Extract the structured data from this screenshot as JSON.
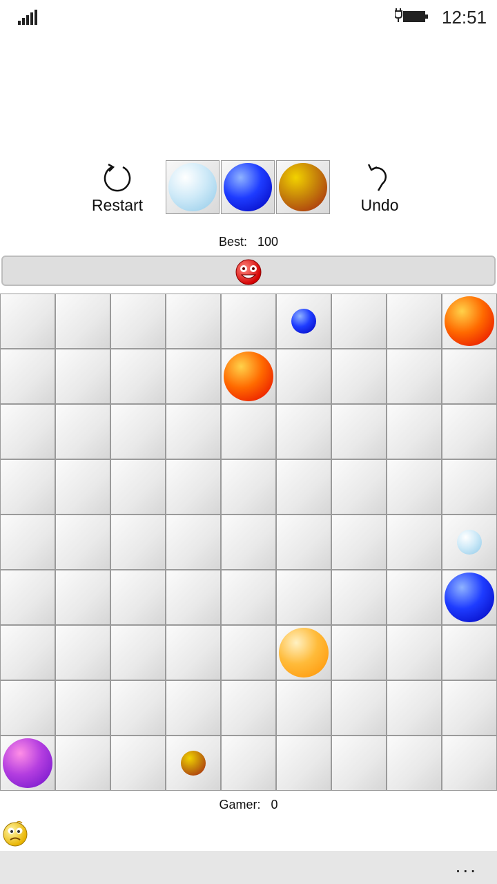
{
  "status": {
    "time": "12:51",
    "signal_icon": "signal-bars-icon",
    "battery_icon": "battery-charging-icon"
  },
  "toolbar": {
    "restart_label": "Restart",
    "restart_icon": "restart-icon",
    "undo_label": "Undo",
    "undo_icon": "undo-icon"
  },
  "next_balls": [
    "lightblue",
    "blue",
    "brown"
  ],
  "best": {
    "label": "Best:",
    "value": "100"
  },
  "progress": {
    "fraction": 0.5,
    "icon": "smiley-face-icon"
  },
  "board": {
    "columns": 9,
    "rows": 9,
    "balls": [
      {
        "row": 0,
        "col": 5,
        "color": "blue",
        "size": "small"
      },
      {
        "row": 0,
        "col": 8,
        "color": "red",
        "size": "large"
      },
      {
        "row": 1,
        "col": 4,
        "color": "red",
        "size": "large"
      },
      {
        "row": 4,
        "col": 8,
        "color": "lightblue",
        "size": "small"
      },
      {
        "row": 5,
        "col": 8,
        "color": "blue",
        "size": "large"
      },
      {
        "row": 6,
        "col": 5,
        "color": "orange",
        "size": "large"
      },
      {
        "row": 8,
        "col": 0,
        "color": "purple",
        "size": "large"
      },
      {
        "row": 8,
        "col": 3,
        "color": "brown",
        "size": "small"
      }
    ]
  },
  "gamer": {
    "label": "Gamer:",
    "value": "0"
  },
  "gamer_icon": "worried-face-icon",
  "app_bar": {
    "more_label": "..."
  },
  "colors": {
    "red": [
      "#ffd24a",
      "#ff6a00",
      "#e30000"
    ],
    "blue": [
      "#8fb3ff",
      "#1e3cff",
      "#0000b8"
    ],
    "lightblue": [
      "#ffffff",
      "#cfeaf8",
      "#8fc9e8"
    ],
    "brown": [
      "#f2d200",
      "#c6820a",
      "#a21f12"
    ],
    "orange": [
      "#fff1c2",
      "#ffbb3a",
      "#ff9000"
    ],
    "purple": [
      "#ff8ee6",
      "#b43ee0",
      "#6a10c8"
    ]
  }
}
